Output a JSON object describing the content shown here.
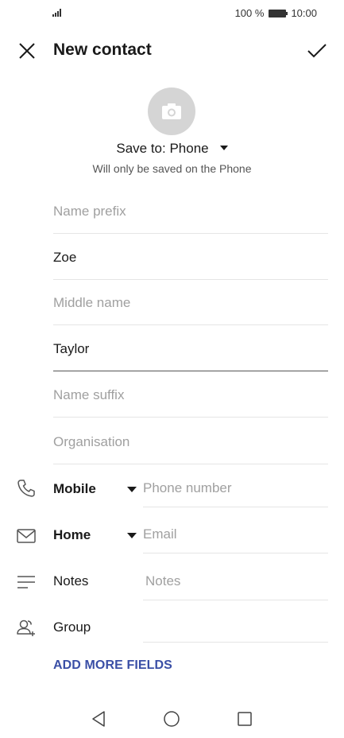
{
  "status_bar": {
    "battery_percent": "100 %",
    "time": "10:00"
  },
  "app_bar": {
    "title": "New contact"
  },
  "save_to": {
    "label": "Save to: Phone",
    "note": "Will only be saved on the Phone"
  },
  "name_fields": [
    {
      "placeholder": "Name prefix",
      "value": ""
    },
    {
      "placeholder": "",
      "value": "Zoe"
    },
    {
      "placeholder": "Middle name",
      "value": ""
    },
    {
      "placeholder": "",
      "value": "Taylor"
    },
    {
      "placeholder": "Name suffix",
      "value": ""
    },
    {
      "placeholder": "Organisation",
      "value": ""
    }
  ],
  "phone_row": {
    "type": "Mobile",
    "placeholder": "Phone number",
    "icon": "phone-icon"
  },
  "email_row": {
    "type": "Home",
    "placeholder": "Email",
    "icon": "mail-icon"
  },
  "notes_row": {
    "label": "Notes",
    "placeholder": "Notes",
    "icon": "notes-icon"
  },
  "group_row": {
    "label": "Group",
    "icon": "group-icon"
  },
  "add_more_fields": "ADD MORE FIELDS",
  "colors": {
    "accent": "#3a4fa6",
    "placeholder": "#a0a0a0",
    "avatar_bg": "#d5d5d5"
  }
}
